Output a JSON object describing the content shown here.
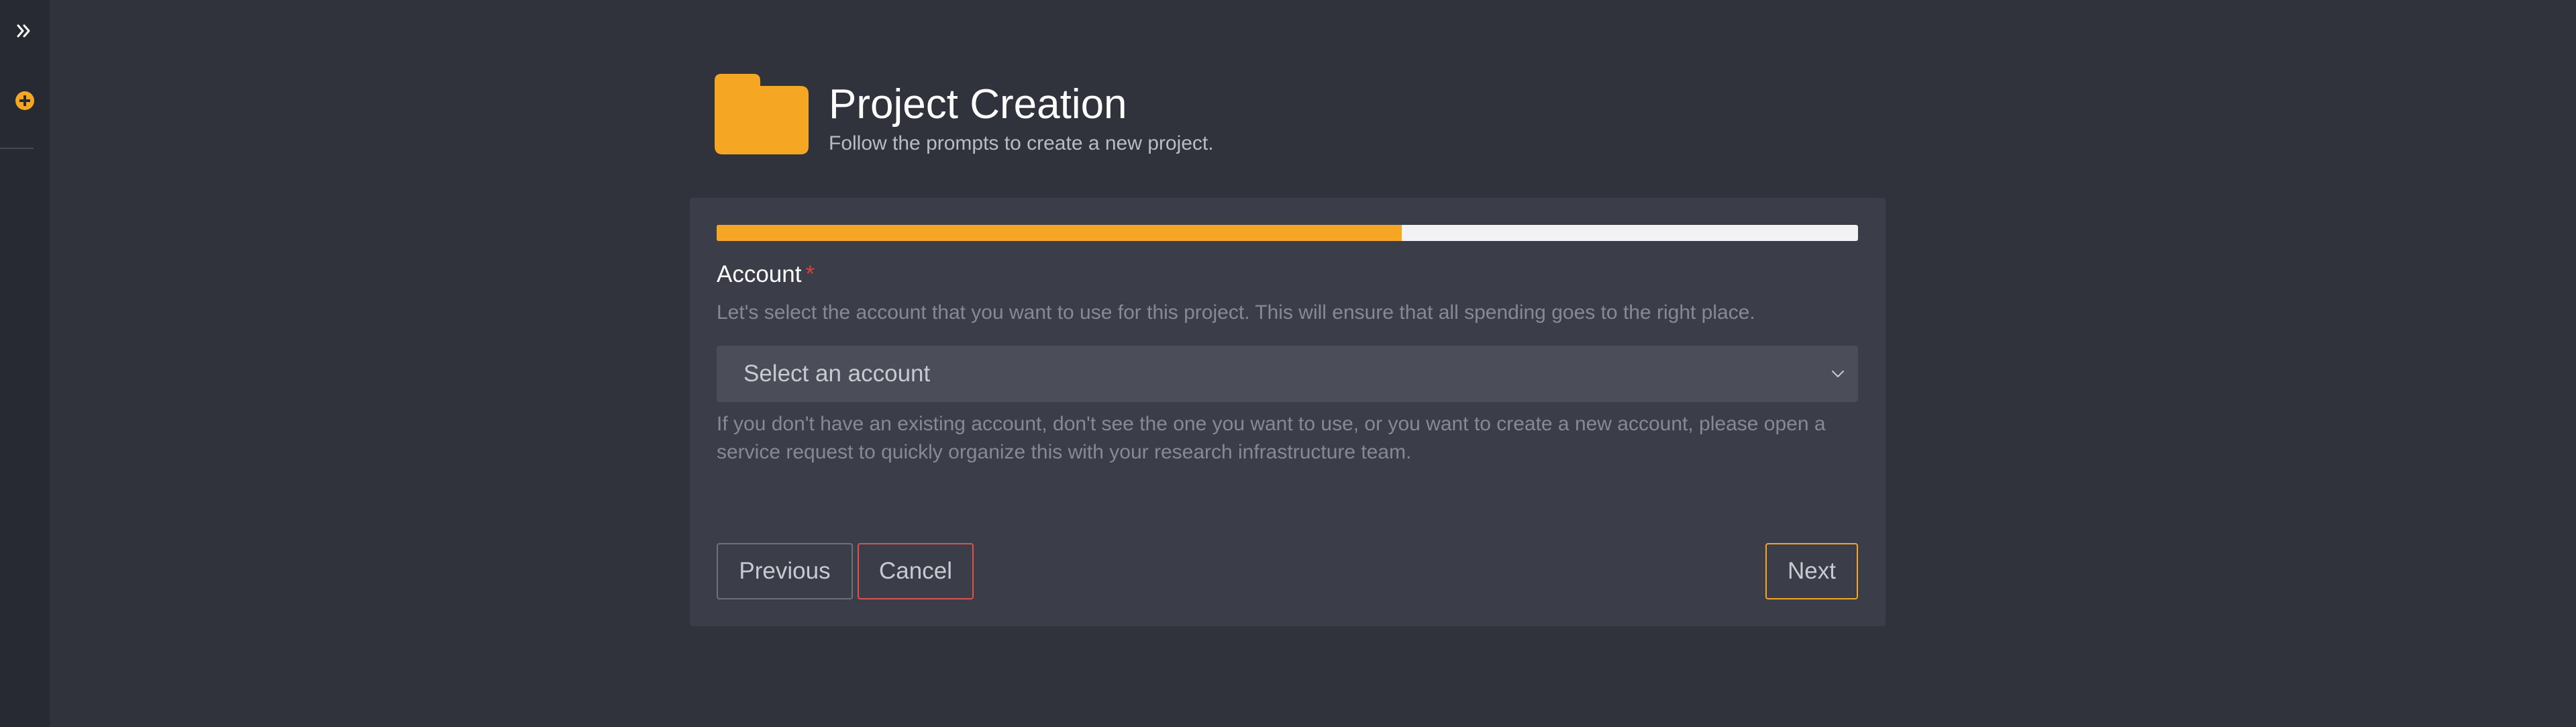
{
  "sidebar": {
    "expand_icon": "double-chevron-right-icon",
    "add_icon": "plus-circle-icon",
    "accent_color": "#f5a623"
  },
  "header": {
    "icon": "folder-icon",
    "title": "Project Creation",
    "subtitle": "Follow the prompts to create a new project."
  },
  "progress": {
    "percent": 60
  },
  "account": {
    "label": "Account",
    "required_marker": "*",
    "description": "Let's select the account that you want to use for this project. This will ensure that all spending goes to the right place.",
    "select_placeholder": "Select an account",
    "help": "If you don't have an existing account, don't see the one you want to use, or you want to create a new account, please open a service request to quickly organize this with your research infrastructure team."
  },
  "buttons": {
    "previous": "Previous",
    "cancel": "Cancel",
    "next": "Next"
  },
  "colors": {
    "accent": "#f5a623",
    "danger": "#d9534f",
    "background": "#30323c",
    "card": "#3b3d48"
  }
}
